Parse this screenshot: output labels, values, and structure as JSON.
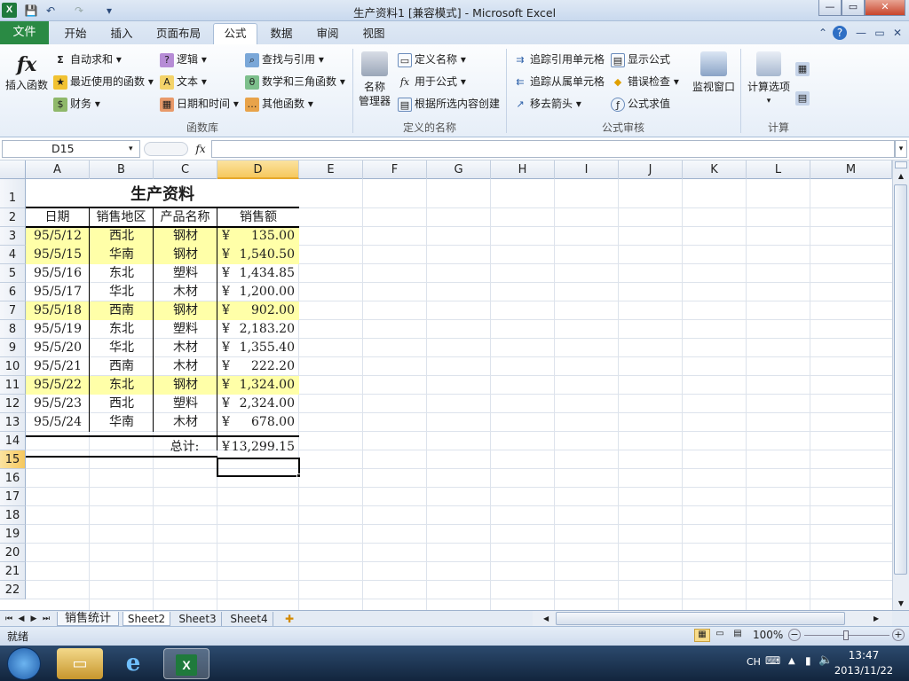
{
  "window": {
    "title": "生产资料1  [兼容模式] - Microsoft Excel",
    "app_icon": "X"
  },
  "quick_access": {
    "save": "💾",
    "undo": "↶",
    "redo": "↷",
    "customize": "▾"
  },
  "window_buttons": {
    "minimize": "—",
    "maximize": "▭",
    "close": "✕"
  },
  "tabs": {
    "file": "文件",
    "items": [
      "开始",
      "插入",
      "页面布局",
      "公式",
      "数据",
      "审阅",
      "视图"
    ],
    "active": "公式"
  },
  "ribbon": {
    "insert_function": "插入函数",
    "library": {
      "autosum": "自动求和",
      "recent": "最近使用的函数",
      "financial": "财务",
      "logical": "逻辑",
      "text": "文本",
      "datetime": "日期和时间",
      "lookup": "查找与引用",
      "math": "数学和三角函数",
      "more": "其他函数",
      "label": "函数库"
    },
    "names": {
      "manager_line1": "名称",
      "manager_line2": "管理器",
      "define": "定义名称",
      "use_in_formula": "用于公式",
      "create_from_selection": "根据所选内容创建",
      "label": "定义的名称"
    },
    "audit": {
      "trace_precedents": "追踪引用单元格",
      "trace_dependents": "追踪从属单元格",
      "remove_arrows": "移去箭头",
      "show_formulas": "显示公式",
      "error_checking": "错误检查",
      "evaluate": "公式求值",
      "label": "公式审核"
    },
    "watch_window": "监视窗口",
    "calc": {
      "options": "计算选项",
      "label": "计算"
    }
  },
  "formula_bar": {
    "name_box": "D15",
    "fx": "fx",
    "value": ""
  },
  "columns": [
    "A",
    "B",
    "C",
    "D",
    "E",
    "F",
    "G",
    "H",
    "I",
    "J",
    "K",
    "L",
    "M"
  ],
  "rows": [
    "1",
    "2",
    "3",
    "4",
    "5",
    "6",
    "7",
    "8",
    "9",
    "10",
    "11",
    "12",
    "13",
    "14",
    "15",
    "16",
    "17",
    "18",
    "19",
    "20",
    "21",
    "22"
  ],
  "selected_cell": "D15",
  "sheet": {
    "title": "生产资料",
    "headers": [
      "日期",
      "销售地区",
      "产品名称",
      "销售额"
    ],
    "records": [
      {
        "date": "95/5/12",
        "region": "西北",
        "product": "钢材",
        "currency": "¥",
        "amount": "135.00",
        "highlight": true
      },
      {
        "date": "95/5/15",
        "region": "华南",
        "product": "钢材",
        "currency": "¥",
        "amount": "1,540.50",
        "highlight": true
      },
      {
        "date": "95/5/16",
        "region": "东北",
        "product": "塑料",
        "currency": "¥",
        "amount": "1,434.85",
        "highlight": false
      },
      {
        "date": "95/5/17",
        "region": "华北",
        "product": "木材",
        "currency": "¥",
        "amount": "1,200.00",
        "highlight": false
      },
      {
        "date": "95/5/18",
        "region": "西南",
        "product": "钢材",
        "currency": "¥",
        "amount": "902.00",
        "highlight": true
      },
      {
        "date": "95/5/19",
        "region": "东北",
        "product": "塑料",
        "currency": "¥",
        "amount": "2,183.20",
        "highlight": false
      },
      {
        "date": "95/5/20",
        "region": "华北",
        "product": "木材",
        "currency": "¥",
        "amount": "1,355.40",
        "highlight": false
      },
      {
        "date": "95/5/21",
        "region": "西南",
        "product": "木材",
        "currency": "¥",
        "amount": "222.20",
        "highlight": false
      },
      {
        "date": "95/5/22",
        "region": "东北",
        "product": "钢材",
        "currency": "¥",
        "amount": "1,324.00",
        "highlight": true
      },
      {
        "date": "95/5/23",
        "region": "西北",
        "product": "塑料",
        "currency": "¥",
        "amount": "2,324.00",
        "highlight": false
      },
      {
        "date": "95/5/24",
        "region": "华南",
        "product": "木材",
        "currency": "¥",
        "amount": "678.00",
        "highlight": false
      }
    ],
    "total_label": "总计:",
    "total_currency": "¥",
    "total_amount": "13,299.15"
  },
  "sheet_tabs": [
    "销售统计",
    "Sheet2",
    "Sheet3",
    "Sheet4"
  ],
  "active_sheet": "Sheet2",
  "status": {
    "ready": "就绪",
    "zoom": "100%"
  },
  "taskbar": {
    "lang": "CH",
    "time": "13:47",
    "date": "2013/11/22"
  },
  "colors": {
    "highlight": "#ffffa8",
    "selected_header": "#f6c85e",
    "file_tab": "#2a8a44"
  }
}
